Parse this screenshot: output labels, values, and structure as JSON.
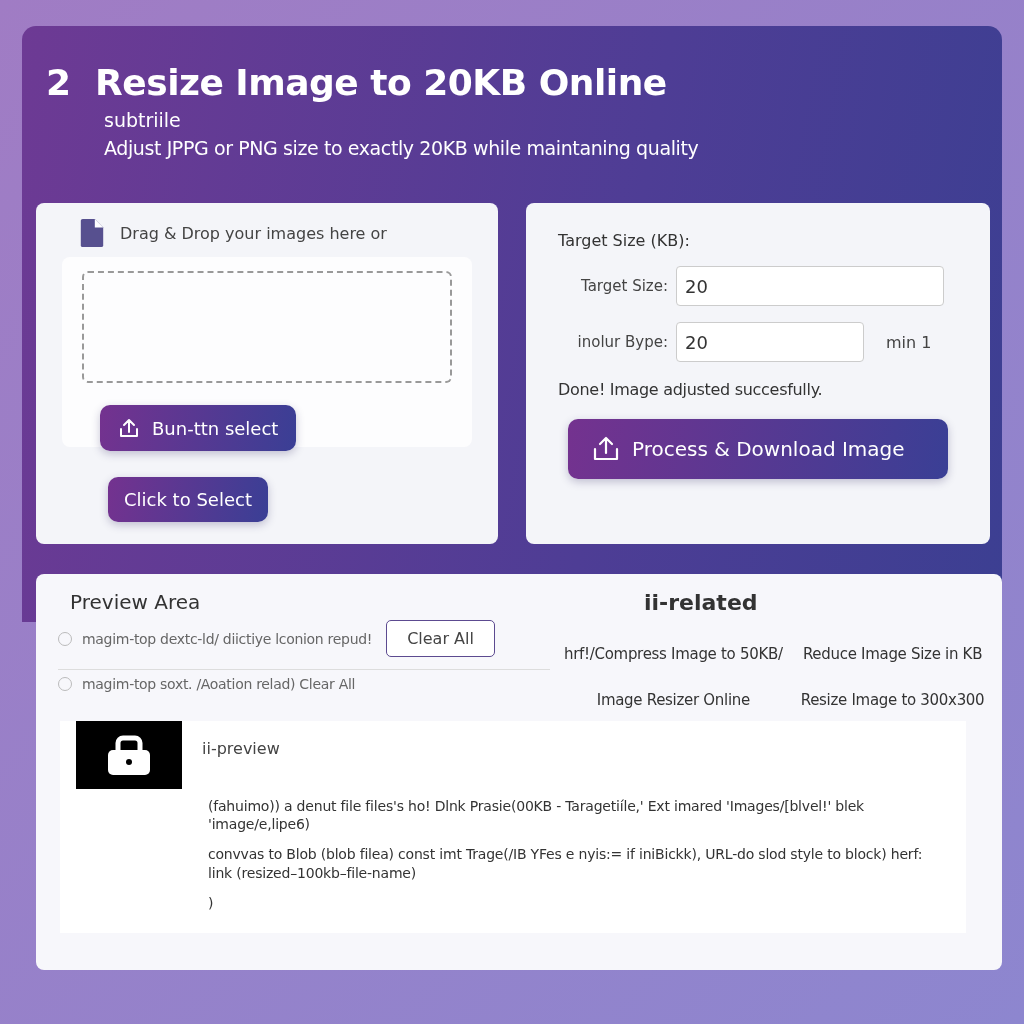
{
  "header": {
    "number": "2",
    "title": "Resize Image to 20KB Online",
    "subtitle": "subtriile",
    "description": "Adjust JPPG or PNG size to exactly 20KB while maintaning quality"
  },
  "upload": {
    "prompt": "Drag & Drop your images here or",
    "buttons": [
      {
        "label": "Bun-ttn select",
        "kind": "icon"
      },
      {
        "label": "Click to Select",
        "kind": "plain"
      }
    ]
  },
  "settings": {
    "heading": "Target Size (KB):",
    "fields": [
      {
        "label": "Target Size:",
        "value": "20",
        "kind": "wide"
      },
      {
        "label": "inolur Bype:",
        "value": "20",
        "kind": "narrow",
        "hint": "min 1"
      }
    ],
    "status": "Done! Image adjusted succesfully.",
    "action": "Process & Download Image"
  },
  "preview": {
    "heading": "Preview Area",
    "options": [
      {
        "label": "magim-top dextc-ld/ diictiye lconion repud!",
        "selected": false,
        "button": "Clear All"
      },
      {
        "label": "magim-top soxt. /Aoation relad) Clear All",
        "selected": false
      }
    ]
  },
  "related": {
    "heading": "ii-related",
    "links": [
      "hrf!/Compress Image to 50KB/",
      "Reduce Image Size in KB",
      "Image Resizer Online",
      "Resize Image to 300x300"
    ]
  },
  "preview_box": {
    "title": "ii-preview",
    "lines": [
      "(fahuimo)) a denut file files's ho! Dlnk Prasie(00KB - Taragetiíle,' Ext imared 'Images/[blvel!' blek 'image/e,lipe6)",
      "convvas to Blob (blob filea) const imt Trage(/IB YFes e nyis:= if iniBickk), URL-do slod style to block) herf: link (resized–100kb–file-name)",
      ")"
    ]
  }
}
